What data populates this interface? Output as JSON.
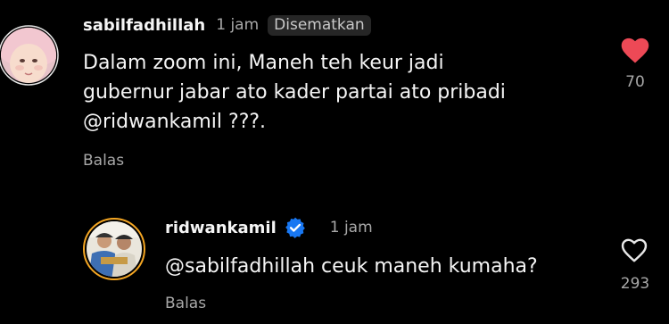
{
  "colors": {
    "background": "#000000",
    "primary_text": "#f5f5f5",
    "secondary_text": "#a8a8a8",
    "pinned_badge_bg": "#262626",
    "liked_heart": "#ed4956",
    "verified_badge": "#1877f2"
  },
  "comments": [
    {
      "username": "sabilfadhillah",
      "time": "1 jam",
      "pinned_label": "Disematkan",
      "text": "Dalam zoom ini, Maneh teh keur jadi\ngubernur jabar ato kader partai ato pribadi\n@ridwankamil ???.",
      "reply_label": "Balas",
      "like_icon": "heart-filled-icon",
      "liked": true,
      "like_count": "70"
    },
    {
      "username": "ridwankamil",
      "verified": true,
      "verified_icon": "verified-badge-icon",
      "time": "1 jam",
      "text": "@sabilfadhillah ceuk maneh kumaha?",
      "reply_label": "Balas",
      "like_icon": "heart-outline-icon",
      "liked": false,
      "like_count": "293"
    }
  ]
}
